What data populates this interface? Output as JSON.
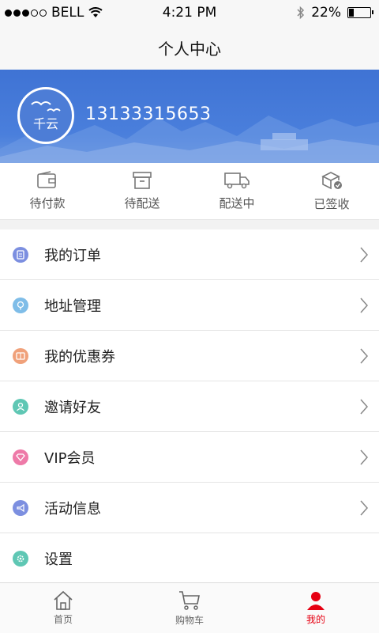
{
  "status_bar": {
    "carrier": "BELL",
    "time": "4:21 PM",
    "battery": "22%",
    "battery_level": 0.22
  },
  "nav": {
    "title": "个人中心"
  },
  "profile": {
    "avatar_text": "千云",
    "phone": "13133315653"
  },
  "orders": [
    {
      "label": "待付款",
      "icon": "wallet-icon"
    },
    {
      "label": "待配送",
      "icon": "box-icon"
    },
    {
      "label": "配送中",
      "icon": "truck-icon"
    },
    {
      "label": "已签收",
      "icon": "signed-box-icon"
    }
  ],
  "menu": [
    {
      "label": "我的订单",
      "icon": "clipboard-icon",
      "color": "#7c8fe0",
      "chevron": true
    },
    {
      "label": "地址管理",
      "icon": "location-icon",
      "color": "#7fbde8",
      "chevron": true
    },
    {
      "label": "我的优惠券",
      "icon": "coupon-icon",
      "color": "#f0a17a",
      "chevron": true
    },
    {
      "label": "邀请好友",
      "icon": "person-icon",
      "color": "#5fc7b4",
      "chevron": true
    },
    {
      "label": "VIP会员",
      "icon": "diamond-icon",
      "color": "#ee7aa8",
      "chevron": true
    },
    {
      "label": "活动信息",
      "icon": "megaphone-icon",
      "color": "#7c8fe0",
      "chevron": true
    },
    {
      "label": "设置",
      "icon": "gear-icon",
      "color": "#5fc7b4",
      "chevron": false
    }
  ],
  "tabs": [
    {
      "label": "首页",
      "icon": "home-icon",
      "active": false
    },
    {
      "label": "购物车",
      "icon": "cart-icon",
      "active": false
    },
    {
      "label": "我的",
      "icon": "user-icon",
      "active": true
    }
  ],
  "colors": {
    "accent": "#e60012",
    "header_blue": "#4a7fdc"
  }
}
